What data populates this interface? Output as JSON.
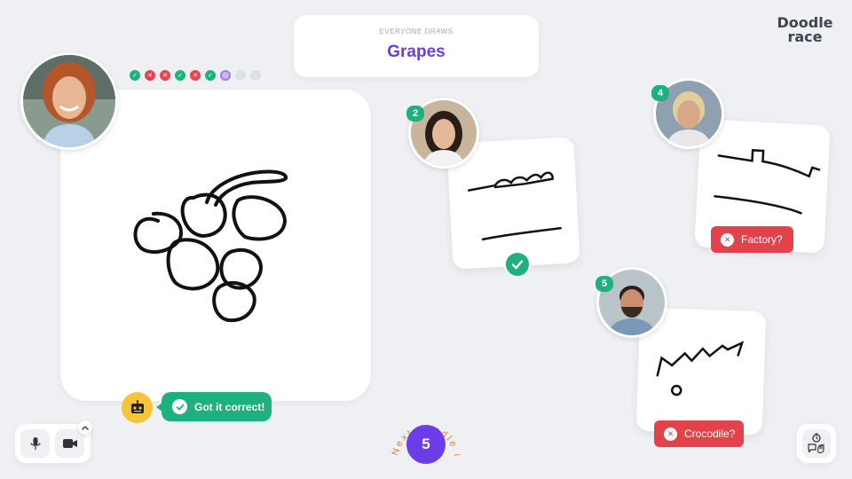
{
  "prompt": {
    "label": "EVERYONE DRAWS",
    "word": "Grapes"
  },
  "logo": {
    "line1": "Doodle",
    "line2": "race"
  },
  "progress": {
    "results": [
      "correct",
      "wrong",
      "wrong",
      "correct",
      "wrong",
      "correct",
      "current",
      "pending",
      "pending"
    ],
    "correct_glyph": "✓",
    "wrong_glyph": "✕"
  },
  "bot": {
    "icon": "robot-icon",
    "message": "Got it correct!"
  },
  "players": [
    {
      "number": "2",
      "result": "correct",
      "guess": ""
    },
    {
      "number": "4",
      "result": "wrong",
      "guess": "Factory?"
    },
    {
      "number": "5",
      "result": "wrong",
      "guess": "Crocodile?"
    }
  ],
  "countdown": {
    "label": "Next doodle in",
    "value": "5"
  },
  "controls": {
    "mic": "microphone-icon",
    "camera": "video-camera-icon",
    "expand": "chevron-up-icon",
    "side": "timer-chat-hand-icon"
  },
  "colors": {
    "accent": "#6c3ce6",
    "correct": "#1fb07f",
    "wrong": "#e2434b",
    "bot": "#f4c53a",
    "background": "#eef0f3"
  }
}
